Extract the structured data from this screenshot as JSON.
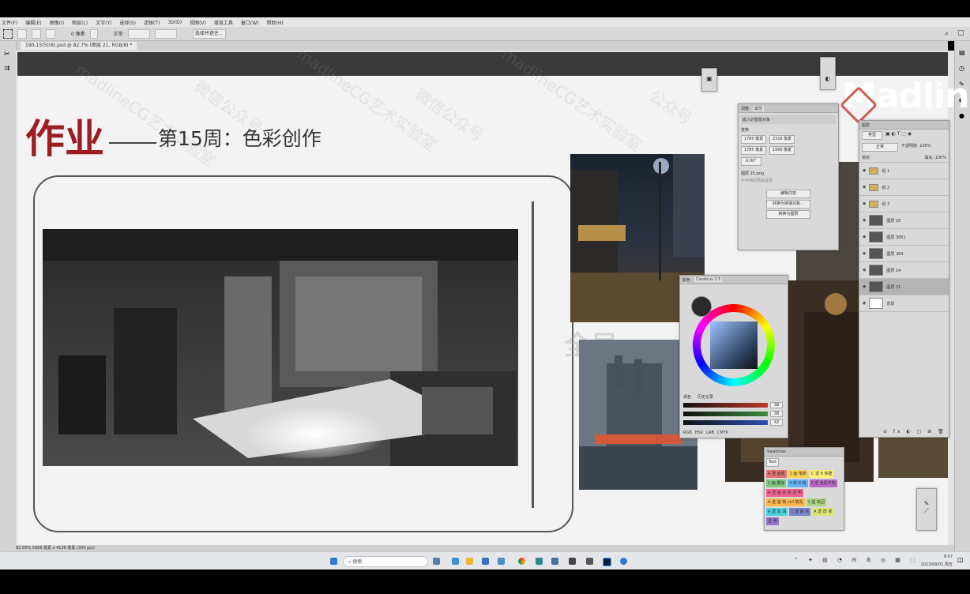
{
  "menu": [
    "文件(F)",
    "编辑(E)",
    "图像(I)",
    "图层(L)",
    "文字(Y)",
    "选择(S)",
    "滤镜(T)",
    "3D(D)",
    "视图(V)",
    "增效工具",
    "窗口(W)",
    "帮助(H)"
  ],
  "options": {
    "mode": "新选区",
    "feather": "0 像素",
    "style": "正常",
    "select_subject": "选择并遮住..."
  },
  "document_tab": "190-15(5)(8).psd @ 82.7% (图层 21, RGB/8) *",
  "slide": {
    "title": "作业",
    "subtitle": "第15周：色彩创作",
    "logo": "Madlin",
    "watermarks": [
      "madlineCG艺术实验室",
      "微信公众号",
      "madlineCG艺术实验室",
      "微信公众号",
      "madlineCG艺术实验室",
      "公众号"
    ]
  },
  "center_watermark": "全局",
  "properties_panel": {
    "tabs": [
      "调整",
      "属性"
    ],
    "type": "嵌入的智能对象",
    "section": "变换",
    "w": "1785 像素",
    "h": "1990 像素",
    "x": "1785 像素",
    "y": "2316 像素",
    "angle": "0.00°",
    "file": "图层 25.png",
    "file_sub": "不可用的预设设置",
    "buttons": [
      "编辑内容",
      "转换为链接对象...",
      "转换为图层"
    ]
  },
  "color_panel": {
    "tabs": [
      "颜色",
      "Coolorus 2.5"
    ],
    "mode_tabs": [
      "RGB",
      "HSV",
      "LAB",
      "CMYK"
    ],
    "sliders": [
      {
        "color": "#c0392b",
        "value": "38"
      },
      {
        "color": "#3b8a3b",
        "value": "38"
      },
      {
        "color": "#2c4fb0",
        "value": "42"
      }
    ],
    "labels": [
      "调色",
      "历史记录"
    ]
  },
  "layers_panel": {
    "title": "图层",
    "kind": "类型",
    "blend": "正常",
    "opacity": "不透明度: 100%",
    "fill": "填充: 100%",
    "lock": "锁定:",
    "layers": [
      {
        "name": "组 1",
        "type": "group"
      },
      {
        "name": "组 2",
        "type": "group"
      },
      {
        "name": "组 3",
        "type": "group"
      },
      {
        "name": "图层 16",
        "type": "layer"
      },
      {
        "name": "图层 3851",
        "type": "layer"
      },
      {
        "name": "图层 384",
        "type": "layer"
      },
      {
        "name": "图层 14",
        "type": "layer"
      },
      {
        "name": "图层 21",
        "type": "layer"
      },
      {
        "name": "背景",
        "type": "background"
      }
    ]
  },
  "swatch_panel": {
    "title": "Swatches",
    "tab": "Text",
    "items": [
      {
        "label": "A 透 画笔",
        "color": "#e57373"
      },
      {
        "label": "1 画 笔刷",
        "color": "#ffd54f"
      },
      {
        "label": "C 透 8 快捷",
        "color": "#fff176"
      },
      {
        "label": "1 画 叠加",
        "color": "#81c784"
      },
      {
        "label": "4 颜 8 锐",
        "color": "#64b5f6"
      },
      {
        "label": "1 透 色彩平衡",
        "color": "#ba68c8"
      },
      {
        "label": "A 透 画 自 锁 透 明",
        "color": "#f06292"
      },
      {
        "label": "A 透 画 锁 ctrl 填充",
        "color": "#ffb74d"
      },
      {
        "label": "1 透 找回",
        "color": "#aed581"
      },
      {
        "label": "A 透 加 深",
        "color": "#4dd0e1"
      },
      {
        "label": "1 透 曲 线",
        "color": "#7986cb"
      },
      {
        "label": "A 透 选 择",
        "color": "#dce775"
      },
      {
        "label": "透 明",
        "color": "#9575cd"
      }
    ]
  },
  "status_bar": "82.69%    5888 像素 x 4138 像素 (300 ppi)",
  "taskbar": {
    "search": "搜索",
    "time": "9:57",
    "date": "2023/09/01 周五",
    "icons": [
      "windows-icon",
      "search-icon",
      "widgets-icon",
      "explorer-icon",
      "store-icon",
      "browser-icon",
      "chrome-icon",
      "photoshop-icon",
      "edge-icon"
    ]
  }
}
